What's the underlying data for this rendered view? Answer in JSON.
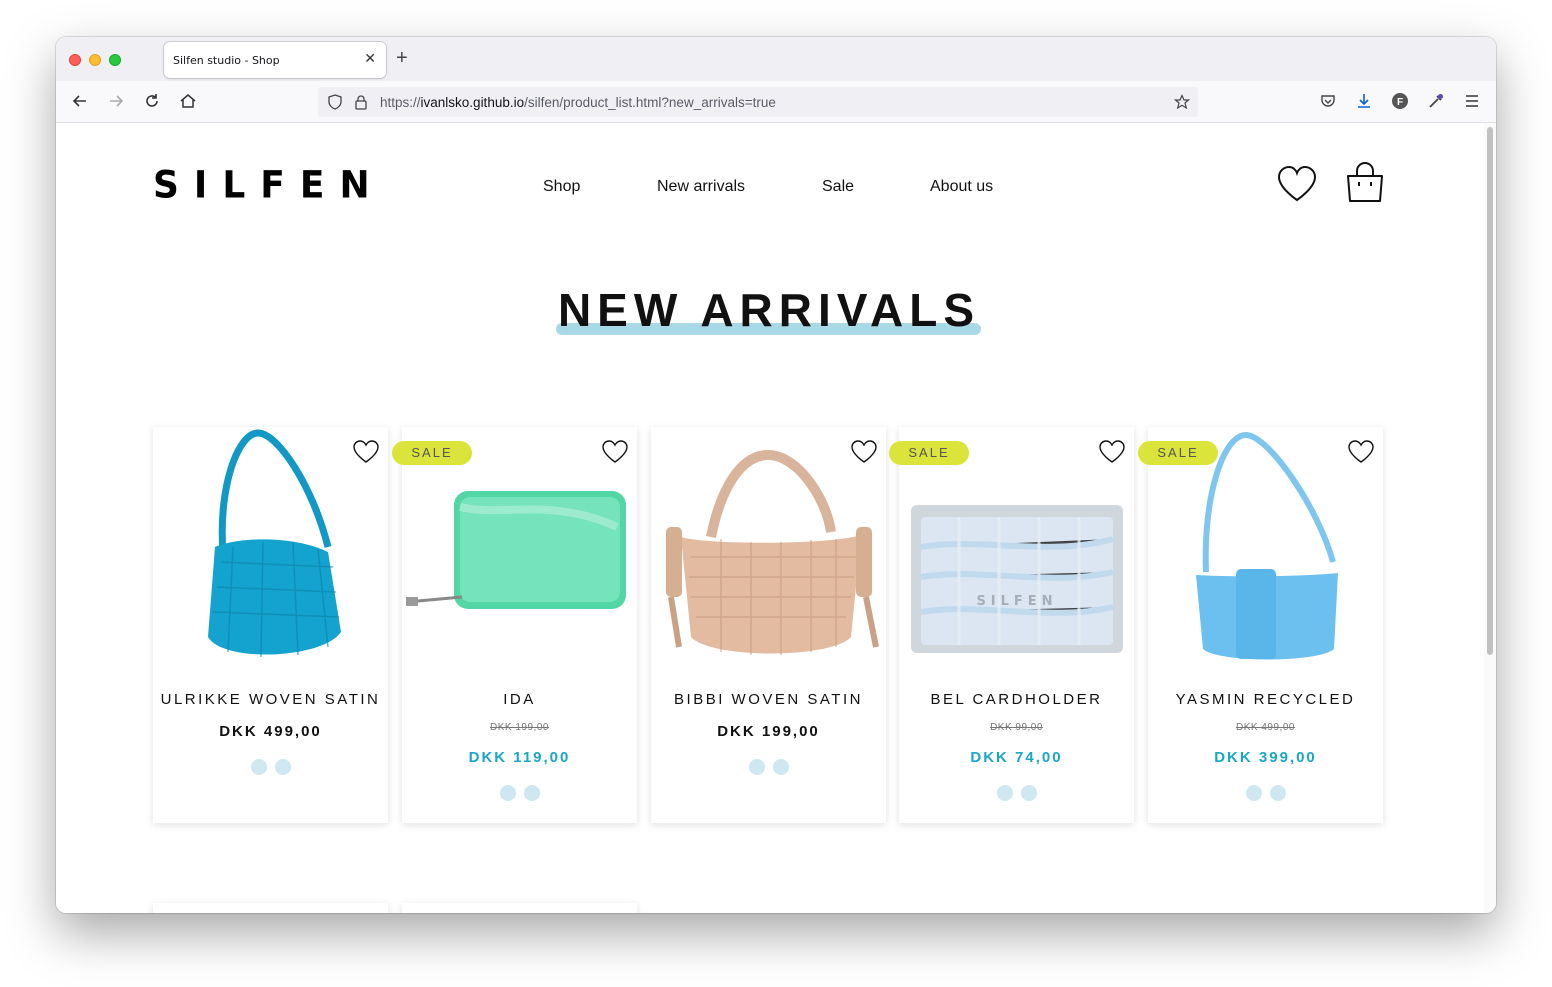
{
  "browser": {
    "tab_title": "Silfen studio - Shop",
    "url_prefix": "https://",
    "url_host": "ivanlsko.github.io",
    "url_path": "/silfen/product_list.html?new_arrivals=true"
  },
  "site": {
    "logo": "SILFEN",
    "nav": [
      "Shop",
      "New arrivals",
      "Sale",
      "About us"
    ],
    "page_heading": "NEW ARRIVALS"
  },
  "colors": {
    "accent": "#1aa7c6",
    "sale_badge": "#dbe43a",
    "heading_underline": "#a9d9e6",
    "dot": "#cfe7f0"
  },
  "products": [
    {
      "name": "ULRIKKE WOVEN SATIN",
      "sale": false,
      "price": "DKK 499,00"
    },
    {
      "name": "IDA",
      "sale": true,
      "badge": "SALE",
      "old_price": "DKK 199,00",
      "price": "DKK 119,00"
    },
    {
      "name": "BIBBI WOVEN SATIN",
      "sale": false,
      "price": "DKK 199,00"
    },
    {
      "name": "BEL CARDHOLDER",
      "sale": true,
      "badge": "SALE",
      "old_price": "DKK 99,00",
      "price": "DKK 74,00"
    },
    {
      "name": "YASMIN RECYCLED",
      "sale": true,
      "badge": "SALE",
      "old_price": "DKK 499,00",
      "price": "DKK 399,00"
    }
  ]
}
